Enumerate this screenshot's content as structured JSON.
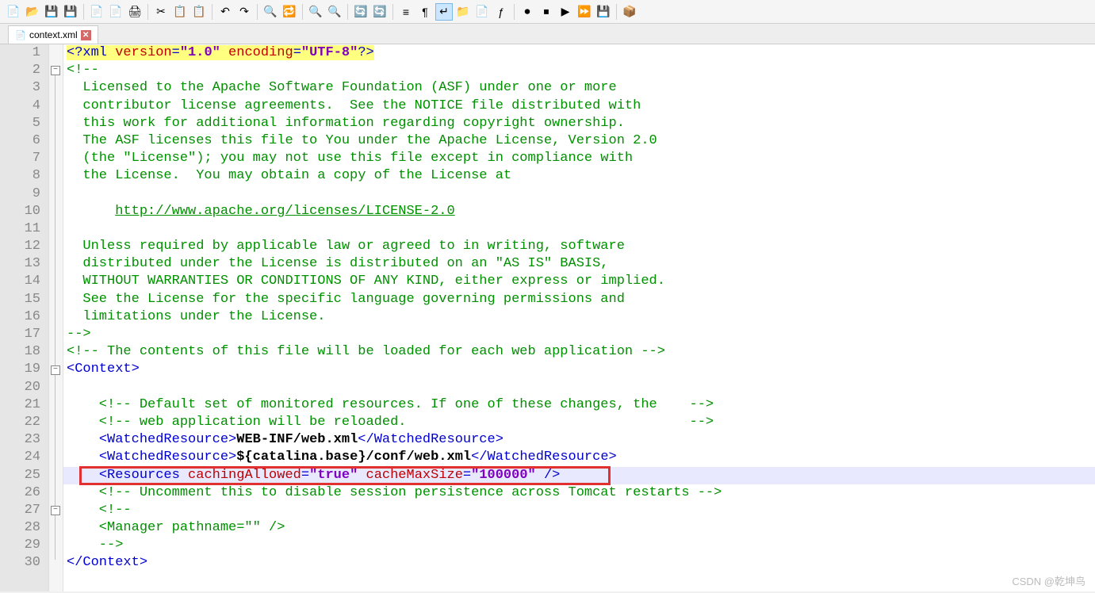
{
  "toolbar": {
    "groups": [
      [
        "new-file-icon",
        "open-icon",
        "save-icon",
        "save-all-icon"
      ],
      [
        "close-icon",
        "close-all-icon",
        "print-icon"
      ],
      [
        "cut-icon",
        "copy-icon",
        "paste-icon"
      ],
      [
        "undo-icon",
        "redo-icon"
      ],
      [
        "find-icon",
        "replace-icon"
      ],
      [
        "zoom-in-icon",
        "zoom-out-icon"
      ],
      [
        "sync-icon",
        "sync-all-icon"
      ],
      [
        "indent-icon",
        "show-ws-icon",
        "wrap-icon",
        "folder-icon",
        "doc-icon",
        "fx-icon"
      ],
      [
        "record-icon",
        "stop-icon",
        "play-icon",
        "fast-forward-icon",
        "save-macro-icon"
      ],
      [
        "tool-icon"
      ]
    ],
    "active": "wrap-icon",
    "glyphs": {
      "new-file-icon": "📄",
      "open-icon": "📂",
      "save-icon": "💾",
      "save-all-icon": "💾",
      "close-icon": "📄",
      "close-all-icon": "📄",
      "print-icon": "🖨",
      "cut-icon": "✂",
      "copy-icon": "📋",
      "paste-icon": "📋",
      "undo-icon": "↶",
      "redo-icon": "↷",
      "find-icon": "🔍",
      "replace-icon": "🔁",
      "zoom-in-icon": "🔍",
      "zoom-out-icon": "🔍",
      "sync-icon": "🔄",
      "sync-all-icon": "🔄",
      "indent-icon": "≡",
      "show-ws-icon": "¶",
      "wrap-icon": "↵",
      "folder-icon": "📁",
      "doc-icon": "📄",
      "fx-icon": "ƒ",
      "record-icon": "⏺",
      "stop-icon": "⏹",
      "play-icon": "▶",
      "fast-forward-icon": "⏩",
      "save-macro-icon": "💾",
      "tool-icon": "📦"
    }
  },
  "tab": {
    "name": "context.xml"
  },
  "watermark": "CSDN @乾坤鸟",
  "code": {
    "lines": [
      {
        "n": 1,
        "t": "xmldecl",
        "seg": [
          [
            "<?",
            "tagbr"
          ],
          [
            "xml",
            "tagname"
          ],
          [
            " version",
            "attr"
          ],
          [
            "=",
            "tagbr"
          ],
          [
            "\"1.0\"",
            "val"
          ],
          [
            " encoding",
            "attr"
          ],
          [
            "=",
            "tagbr"
          ],
          [
            "\"UTF-8\"",
            "val"
          ],
          [
            "?>",
            "tagbr"
          ]
        ]
      },
      {
        "n": 2,
        "t": "cmnt",
        "seg": [
          [
            "<!--",
            "cmnt"
          ]
        ],
        "fold": "minus"
      },
      {
        "n": 3,
        "t": "cmnt",
        "seg": [
          [
            "  Licensed to the Apache Software Foundation (ASF) under one or more",
            "cmnt"
          ]
        ]
      },
      {
        "n": 4,
        "t": "cmnt",
        "seg": [
          [
            "  contributor license agreements.  See the NOTICE file distributed with",
            "cmnt"
          ]
        ]
      },
      {
        "n": 5,
        "t": "cmnt",
        "seg": [
          [
            "  this work for additional information regarding copyright ownership.",
            "cmnt"
          ]
        ]
      },
      {
        "n": 6,
        "t": "cmnt",
        "seg": [
          [
            "  The ASF licenses this file to You under the Apache License, Version 2.0",
            "cmnt"
          ]
        ]
      },
      {
        "n": 7,
        "t": "cmnt",
        "seg": [
          [
            "  (the \"License\"); you may not use this file except in compliance with",
            "cmnt"
          ]
        ]
      },
      {
        "n": 8,
        "t": "cmnt",
        "seg": [
          [
            "  the License.  You may obtain a copy of the License at",
            "cmnt"
          ]
        ]
      },
      {
        "n": 9,
        "t": "cmnt",
        "seg": [
          [
            "",
            "cmnt"
          ]
        ]
      },
      {
        "n": 10,
        "t": "cmnt",
        "seg": [
          [
            "      ",
            "cmnt"
          ],
          [
            "http://www.apache.org/licenses/LICENSE-2.0",
            "url"
          ]
        ]
      },
      {
        "n": 11,
        "t": "cmnt",
        "seg": [
          [
            "",
            "cmnt"
          ]
        ]
      },
      {
        "n": 12,
        "t": "cmnt",
        "seg": [
          [
            "  Unless required by applicable law or agreed to in writing, software",
            "cmnt"
          ]
        ]
      },
      {
        "n": 13,
        "t": "cmnt",
        "seg": [
          [
            "  distributed under the License is distributed on an \"AS IS\" BASIS,",
            "cmnt"
          ]
        ]
      },
      {
        "n": 14,
        "t": "cmnt",
        "seg": [
          [
            "  WITHOUT WARRANTIES OR CONDITIONS OF ANY KIND, either express or implied.",
            "cmnt"
          ]
        ]
      },
      {
        "n": 15,
        "t": "cmnt",
        "seg": [
          [
            "  See the License for the specific language governing permissions and",
            "cmnt"
          ]
        ]
      },
      {
        "n": 16,
        "t": "cmnt",
        "seg": [
          [
            "  limitations under the License.",
            "cmnt"
          ]
        ]
      },
      {
        "n": 17,
        "t": "cmnt",
        "seg": [
          [
            "-->",
            "cmnt"
          ]
        ]
      },
      {
        "n": 18,
        "t": "cmnt",
        "seg": [
          [
            "<!-- The contents of this file will be loaded for each web application -->",
            "cmnt"
          ]
        ]
      },
      {
        "n": 19,
        "t": "tag",
        "seg": [
          [
            "<",
            "tagbr"
          ],
          [
            "Context",
            "tagname"
          ],
          [
            ">",
            "tagbr"
          ]
        ],
        "fold": "minus"
      },
      {
        "n": 20,
        "t": "",
        "seg": [
          [
            "",
            ""
          ]
        ]
      },
      {
        "n": 21,
        "t": "cmnt",
        "seg": [
          [
            "    <!-- Default set of monitored resources. If one of these changes, the    -->",
            "cmnt"
          ]
        ]
      },
      {
        "n": 22,
        "t": "cmnt",
        "seg": [
          [
            "    <!-- web application will be reloaded.                                   -->",
            "cmnt"
          ]
        ]
      },
      {
        "n": 23,
        "t": "tag",
        "seg": [
          [
            "    ",
            ""
          ],
          [
            "<",
            "tagbr"
          ],
          [
            "WatchedResource",
            "tagname"
          ],
          [
            ">",
            "tagbr"
          ],
          [
            "WEB-INF/web.xml",
            "txt"
          ],
          [
            "</",
            "tagbr"
          ],
          [
            "WatchedResource",
            "tagname"
          ],
          [
            ">",
            "tagbr"
          ]
        ]
      },
      {
        "n": 24,
        "t": "tag",
        "seg": [
          [
            "    ",
            ""
          ],
          [
            "<",
            "tagbr"
          ],
          [
            "WatchedResource",
            "tagname"
          ],
          [
            ">",
            "tagbr"
          ],
          [
            "${catalina.base}/conf/web.xml",
            "txt"
          ],
          [
            "</",
            "tagbr"
          ],
          [
            "WatchedResource",
            "tagname"
          ],
          [
            ">",
            "tagbr"
          ]
        ]
      },
      {
        "n": 25,
        "t": "tag",
        "highlight": true,
        "redbox": true,
        "seg": [
          [
            "    ",
            ""
          ],
          [
            "<",
            "tagbr"
          ],
          [
            "Resources",
            "tagname"
          ],
          [
            " cachingAllowed",
            "attr"
          ],
          [
            "=",
            "tagbr"
          ],
          [
            "\"true\"",
            "val"
          ],
          [
            " cacheMaxSize",
            "attr"
          ],
          [
            "=",
            "tagbr"
          ],
          [
            "\"100000\"",
            "val"
          ],
          [
            " />",
            "tagbr"
          ]
        ]
      },
      {
        "n": 26,
        "t": "cmnt",
        "seg": [
          [
            "    <!-- Uncomment this to disable session persistence across Tomcat restarts -->",
            "cmnt"
          ]
        ]
      },
      {
        "n": 27,
        "t": "cmnt",
        "seg": [
          [
            "    <!--",
            "cmnt"
          ]
        ],
        "fold": "minus"
      },
      {
        "n": 28,
        "t": "cmnt",
        "seg": [
          [
            "    <Manager pathname=\"\" />",
            "cmnt"
          ]
        ]
      },
      {
        "n": 29,
        "t": "cmnt",
        "seg": [
          [
            "    -->",
            "cmnt"
          ]
        ]
      },
      {
        "n": 30,
        "t": "tag",
        "seg": [
          [
            "</",
            "tagbr"
          ],
          [
            "Context",
            "tagname"
          ],
          [
            ">",
            "tagbr"
          ]
        ]
      }
    ]
  }
}
